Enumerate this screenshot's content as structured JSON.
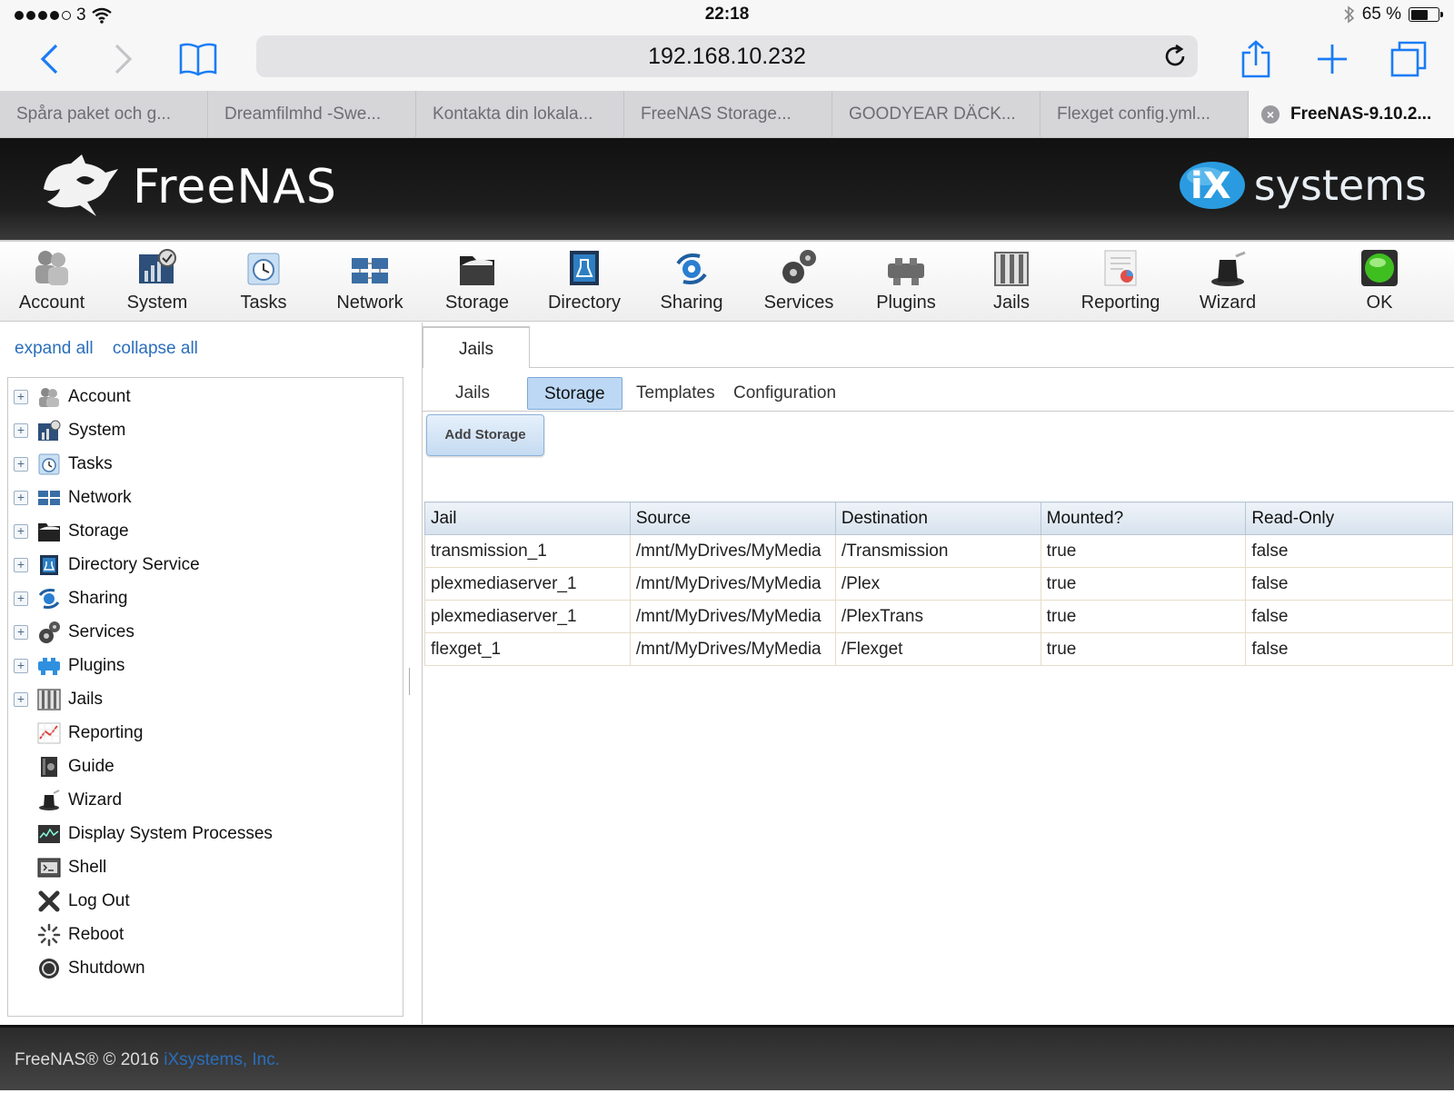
{
  "status": {
    "carrier": "3",
    "time": "22:18",
    "battery": "65 %",
    "battery_level": 0.65
  },
  "browser": {
    "url": "192.168.10.232",
    "tabs": [
      {
        "label": "Spåra paket och g..."
      },
      {
        "label": "Dreamfilmhd -Swe..."
      },
      {
        "label": "Kontakta din lokala..."
      },
      {
        "label": "FreeNAS Storage..."
      },
      {
        "label": "GOODYEAR DÄCK..."
      },
      {
        "label": "Flexget config.yml..."
      },
      {
        "label": "FreeNAS-9.10.2..."
      }
    ]
  },
  "header": {
    "brand": "FreeNAS",
    "vendor": "systems",
    "vendor_prefix": "iX"
  },
  "menu": {
    "items": [
      {
        "label": "Account"
      },
      {
        "label": "System"
      },
      {
        "label": "Tasks"
      },
      {
        "label": "Network"
      },
      {
        "label": "Storage"
      },
      {
        "label": "Directory"
      },
      {
        "label": "Sharing"
      },
      {
        "label": "Services"
      },
      {
        "label": "Plugins"
      },
      {
        "label": "Jails"
      },
      {
        "label": "Reporting"
      },
      {
        "label": "Wizard"
      },
      {
        "label": "OK"
      }
    ]
  },
  "sidebar": {
    "expand_all": "expand all",
    "collapse_all": "collapse all",
    "items": [
      {
        "label": "Account"
      },
      {
        "label": "System"
      },
      {
        "label": "Tasks"
      },
      {
        "label": "Network"
      },
      {
        "label": "Storage"
      },
      {
        "label": "Directory Service"
      },
      {
        "label": "Sharing"
      },
      {
        "label": "Services"
      },
      {
        "label": "Plugins"
      },
      {
        "label": "Jails"
      },
      {
        "label": "Reporting"
      },
      {
        "label": "Guide"
      },
      {
        "label": "Wizard"
      },
      {
        "label": "Display System Processes"
      },
      {
        "label": "Shell"
      },
      {
        "label": "Log Out"
      },
      {
        "label": "Reboot"
      },
      {
        "label": "Shutdown"
      }
    ]
  },
  "main": {
    "top_tab": "Jails",
    "subtabs": [
      "Jails",
      "Storage",
      "Templates",
      "Configuration"
    ],
    "add_button": "Add Storage",
    "columns": [
      "Jail",
      "Source",
      "Destination",
      "Mounted?",
      "Read-Only"
    ],
    "rows": [
      [
        "transmission_1",
        "/mnt/MyDrives/MyMedia",
        "/Transmission",
        "true",
        "false"
      ],
      [
        "plexmediaserver_1",
        "/mnt/MyDrives/MyMedia",
        "/Plex",
        "true",
        "false"
      ],
      [
        "plexmediaserver_1",
        "/mnt/MyDrives/MyMedia",
        "/PlexTrans",
        "true",
        "false"
      ],
      [
        "flexget_1",
        "/mnt/MyDrives/MyMedia",
        "/Flexget",
        "true",
        "false"
      ]
    ]
  },
  "footer": {
    "text": "FreeNAS® © 2016",
    "company": "iXsystems, Inc."
  }
}
